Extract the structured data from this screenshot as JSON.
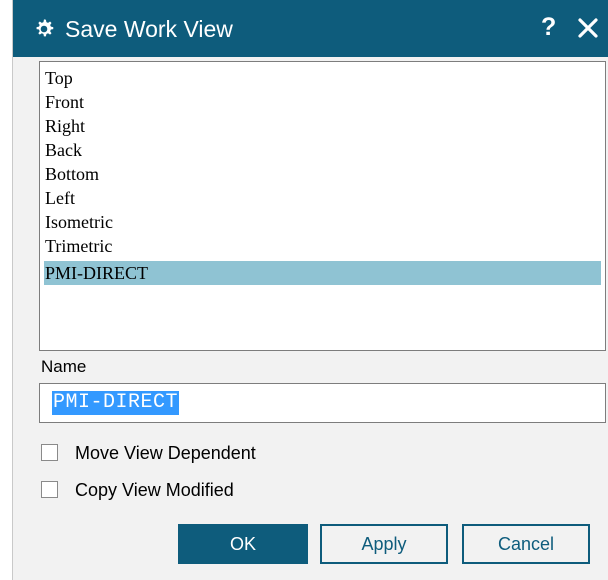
{
  "dialog": {
    "title": "Save Work View",
    "help_label": "?",
    "accent_color": "#0e5c7c",
    "title_icon": "gear-icon",
    "close_icon": "close-icon"
  },
  "views": {
    "items": [
      "Top",
      "Front",
      "Right",
      "Back",
      "Bottom",
      "Left",
      "Isometric",
      "Trimetric",
      "PMI-DIRECT"
    ],
    "selected": "PMI-DIRECT"
  },
  "name_field": {
    "label": "Name",
    "value": "PMI-DIRECT"
  },
  "options": {
    "move_view_dependent": {
      "label": "Move View Dependent",
      "checked": false
    },
    "copy_view_modified": {
      "label": "Copy View Modified",
      "checked": false
    }
  },
  "buttons": {
    "ok": "OK",
    "apply": "Apply",
    "cancel": "Cancel"
  }
}
